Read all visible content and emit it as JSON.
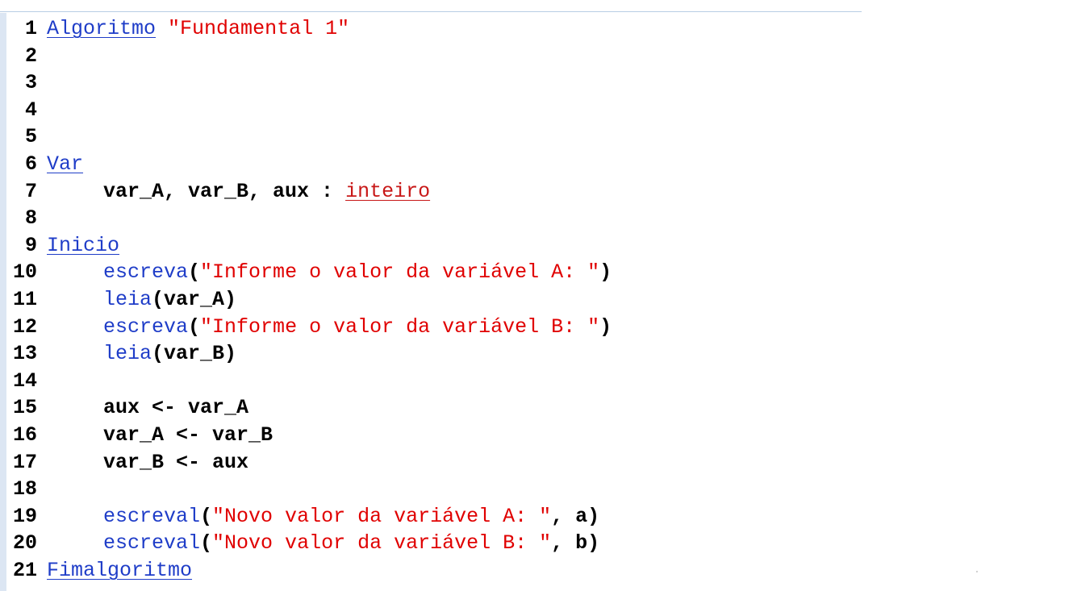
{
  "editor": {
    "lines": [
      {
        "num": "1",
        "parts": [
          {
            "cls": "kw",
            "text": "Algoritmo"
          },
          {
            "cls": "plain",
            "text": " "
          },
          {
            "cls": "str",
            "text": "\"Fundamental 1\""
          }
        ],
        "indent": false
      },
      {
        "num": "2",
        "parts": [],
        "indent": false
      },
      {
        "num": "3",
        "parts": [],
        "indent": false
      },
      {
        "num": "4",
        "parts": [],
        "indent": false
      },
      {
        "num": "5",
        "parts": [],
        "indent": false
      },
      {
        "num": "6",
        "parts": [
          {
            "cls": "kw",
            "text": "Var"
          }
        ],
        "indent": false
      },
      {
        "num": "7",
        "parts": [
          {
            "cls": "plain",
            "text": "var_A, var_B, aux : "
          },
          {
            "cls": "type",
            "text": "inteiro"
          }
        ],
        "indent": true
      },
      {
        "num": "8",
        "parts": [],
        "indent": false
      },
      {
        "num": "9",
        "parts": [
          {
            "cls": "kw",
            "text": "Inicio"
          }
        ],
        "indent": false
      },
      {
        "num": "10",
        "parts": [
          {
            "cls": "fn",
            "text": "escreva"
          },
          {
            "cls": "plain",
            "text": "("
          },
          {
            "cls": "str",
            "text": "\"Informe o valor da variável A: \""
          },
          {
            "cls": "plain",
            "text": ")"
          }
        ],
        "indent": true
      },
      {
        "num": "11",
        "parts": [
          {
            "cls": "fn",
            "text": "leia"
          },
          {
            "cls": "plain",
            "text": "(var_A)"
          }
        ],
        "indent": true
      },
      {
        "num": "12",
        "parts": [
          {
            "cls": "fn",
            "text": "escreva"
          },
          {
            "cls": "plain",
            "text": "("
          },
          {
            "cls": "str",
            "text": "\"Informe o valor da variável B: \""
          },
          {
            "cls": "plain",
            "text": ")"
          }
        ],
        "indent": true
      },
      {
        "num": "13",
        "parts": [
          {
            "cls": "fn",
            "text": "leia"
          },
          {
            "cls": "plain",
            "text": "(var_B)"
          }
        ],
        "indent": true
      },
      {
        "num": "14",
        "parts": [],
        "indent": false
      },
      {
        "num": "15",
        "parts": [
          {
            "cls": "plain",
            "text": "aux <- var_A"
          }
        ],
        "indent": true
      },
      {
        "num": "16",
        "parts": [
          {
            "cls": "plain",
            "text": "var_A <- var_B"
          }
        ],
        "indent": true
      },
      {
        "num": "17",
        "parts": [
          {
            "cls": "plain",
            "text": "var_B <- aux"
          }
        ],
        "indent": true
      },
      {
        "num": "18",
        "parts": [],
        "indent": false
      },
      {
        "num": "19",
        "parts": [
          {
            "cls": "fn",
            "text": "escreval"
          },
          {
            "cls": "plain",
            "text": "("
          },
          {
            "cls": "str",
            "text": "\"Novo valor da variável A: \""
          },
          {
            "cls": "plain",
            "text": ", a)"
          }
        ],
        "indent": true
      },
      {
        "num": "20",
        "parts": [
          {
            "cls": "fn",
            "text": "escreval"
          },
          {
            "cls": "plain",
            "text": "("
          },
          {
            "cls": "str",
            "text": "\"Novo valor da variável B: \""
          },
          {
            "cls": "plain",
            "text": ", b)"
          }
        ],
        "indent": true
      },
      {
        "num": "21",
        "parts": [
          {
            "cls": "kw",
            "text": "Fimalgoritmo"
          }
        ],
        "indent": false
      }
    ]
  },
  "colors": {
    "keyword": "#1f3dc8",
    "string": "#e00000",
    "type": "#c81818",
    "gutter": "#dce6f3"
  },
  "corner_mark": "."
}
